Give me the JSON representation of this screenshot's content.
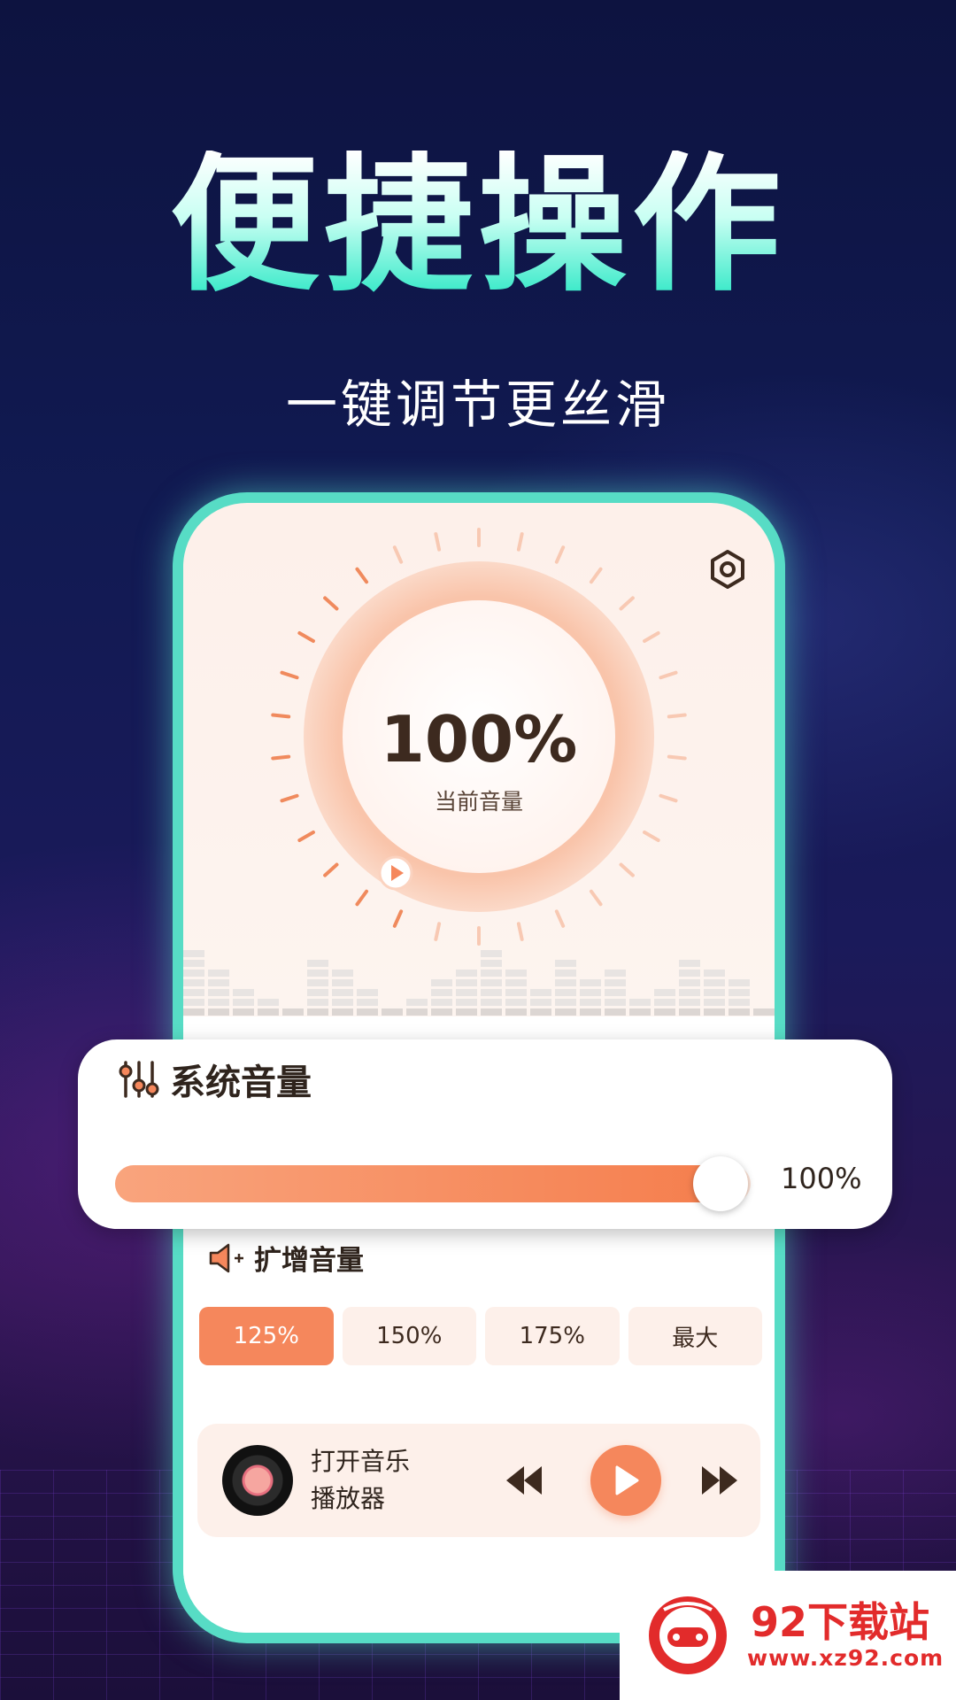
{
  "headline": "便捷操作",
  "subheadline": "一键调节更丝滑",
  "dial": {
    "value": "100%",
    "label": "当前音量",
    "level": 1.0
  },
  "system_volume": {
    "title": "系统音量",
    "value_text": "100%",
    "level": 1.0
  },
  "boost": {
    "title": "扩增音量",
    "presets": [
      "125%",
      "150%",
      "175%",
      "最大"
    ],
    "selected": "125%"
  },
  "player": {
    "label_line1": "打开音乐",
    "label_line2": "播放器"
  },
  "watermark": {
    "title": "92下载站",
    "url": "www.xz92.com"
  },
  "colors": {
    "accent": "#f5875c",
    "frame": "#57dcc5",
    "watermark": "#e22b2b"
  },
  "icons": [
    "settings-icon",
    "play-icon",
    "equalizer-icon",
    "speaker-plus-icon",
    "previous-icon",
    "next-icon",
    "vinyl-icon"
  ]
}
